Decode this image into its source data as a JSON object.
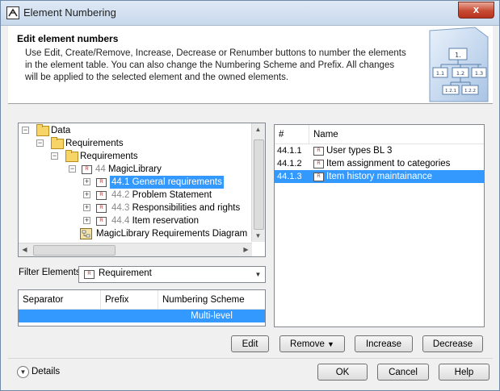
{
  "window": {
    "title": "Element Numbering",
    "close_glyph": "x"
  },
  "header": {
    "title": "Edit element numbers",
    "description": "Use Edit, Create/Remove, Increase, Decrease or Renumber buttons to number the elements in the element table. You can also change the Numbering Scheme and Prefix. All changes will be applied to the selected element and the owned elements.",
    "graphic": {
      "root": "1.",
      "children": [
        "1.1",
        "1.2",
        "1.3"
      ],
      "leaves": [
        "1.2.1",
        "1.2.2"
      ]
    }
  },
  "tree": {
    "items": [
      {
        "label": "Data",
        "icon": "package-folder-icon"
      },
      {
        "label": "Requirements",
        "icon": "folder-icon"
      },
      {
        "label": "Requirements",
        "icon": "folder-icon"
      },
      {
        "number": "44",
        "label": "MagicLibrary",
        "icon": "requirement-icon"
      },
      {
        "number": "44.1",
        "label": "General requirements",
        "icon": "requirement-icon",
        "selected": true
      },
      {
        "number": "44.2",
        "label": "Problem Statement",
        "icon": "requirement-icon"
      },
      {
        "number": "44.3",
        "label": "Responsibilities and rights",
        "icon": "requirement-icon"
      },
      {
        "number": "44.4",
        "label": "Item reservation",
        "icon": "requirement-icon"
      },
      {
        "label": "MagicLibrary Requirements Diagram",
        "icon": "diagram-icon"
      }
    ],
    "req_icon_text": "R"
  },
  "filter": {
    "label": "Filter Elements",
    "value": "Requirement"
  },
  "separator_table": {
    "headers": [
      "Separator",
      "Prefix",
      "Numbering Scheme"
    ],
    "row": {
      "separator": "",
      "prefix": "",
      "scheme": "Multi-level"
    }
  },
  "element_table": {
    "headers": [
      "#",
      "Name"
    ],
    "rows": [
      {
        "num": "44.1.1",
        "name": "User types BL 3"
      },
      {
        "num": "44.1.2",
        "name": "Item assignment to categories"
      },
      {
        "num": "44.1.3",
        "name": "Item history maintainance",
        "selected": true
      }
    ]
  },
  "buttons": {
    "edit": "Edit",
    "remove": "Remove",
    "increase": "Increase",
    "decrease": "Decrease",
    "ok": "OK",
    "cancel": "Cancel",
    "help": "Help"
  },
  "details": {
    "label": "Details"
  },
  "colors": {
    "selection": "#3399ff",
    "title_bar": "#c7d8ec",
    "close": "#c74b33"
  }
}
